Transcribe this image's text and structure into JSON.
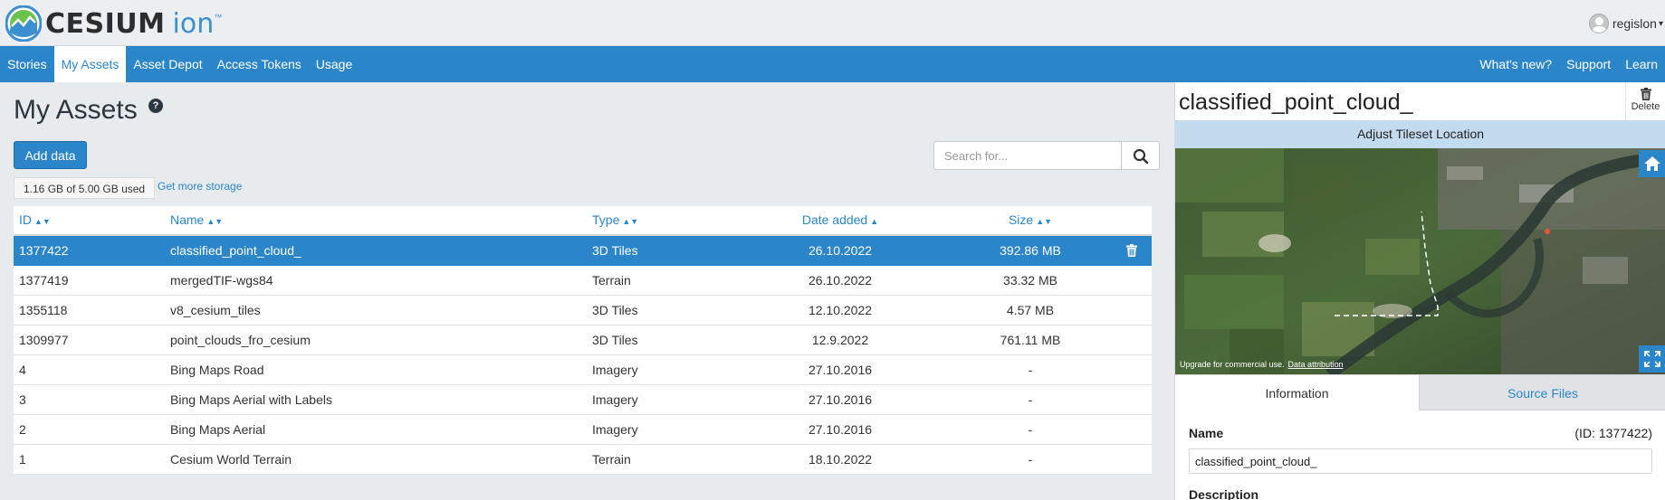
{
  "header": {
    "logo_text": "CESIUM",
    "logo_ion": "ion",
    "logo_tm": "™",
    "user_name": "regislon"
  },
  "nav": {
    "left": [
      "Stories",
      "My Assets",
      "Asset Depot",
      "Access Tokens",
      "Usage"
    ],
    "active": "My Assets",
    "right": [
      "What's new?",
      "Support",
      "Learn"
    ]
  },
  "assets": {
    "title": "My Assets",
    "help": "?",
    "add_label": "Add data",
    "storage_used": "1.16 GB of 5.00 GB used",
    "more_storage": "Get more storage",
    "search_placeholder": "Search for...",
    "columns": {
      "id": "ID",
      "name": "Name",
      "type": "Type",
      "date": "Date added",
      "size": "Size"
    },
    "rows": [
      {
        "id": "1377422",
        "name": "classified_point_cloud_",
        "type": "3D Tiles",
        "date": "26.10.2022",
        "size": "392.86 MB",
        "selected": true
      },
      {
        "id": "1377419",
        "name": "mergedTIF-wgs84",
        "type": "Terrain",
        "date": "26.10.2022",
        "size": "33.32 MB"
      },
      {
        "id": "1355118",
        "name": "v8_cesium_tiles",
        "type": "3D Tiles",
        "date": "12.10.2022",
        "size": "4.57 MB"
      },
      {
        "id": "1309977",
        "name": "point_clouds_fro_cesium",
        "type": "3D Tiles",
        "date": "12.9.2022",
        "size": "761.11 MB"
      },
      {
        "id": "4",
        "name": "Bing Maps Road",
        "type": "Imagery",
        "date": "27.10.2016",
        "size": "-"
      },
      {
        "id": "3",
        "name": "Bing Maps Aerial with Labels",
        "type": "Imagery",
        "date": "27.10.2016",
        "size": "-"
      },
      {
        "id": "2",
        "name": "Bing Maps Aerial",
        "type": "Imagery",
        "date": "27.10.2016",
        "size": "-"
      },
      {
        "id": "1",
        "name": "Cesium World Terrain",
        "type": "Terrain",
        "date": "18.10.2022",
        "size": "-"
      }
    ]
  },
  "detail": {
    "title": "classified_point_cloud_",
    "delete_label": "Delete",
    "adjust_label": "Adjust Tileset Location",
    "credits": "Upgrade for commercial use.",
    "attribution": "Data attribution",
    "tabs": [
      "Information",
      "Source Files"
    ],
    "name_label": "Name",
    "id_text": "(ID:   1377422)",
    "name_value": "classified_point_cloud_",
    "description_label": "Description"
  },
  "colors": {
    "brand_blue": "#2b86c9",
    "selected_row": "#2b86c9",
    "adjust_bar": "#c2dbef"
  }
}
